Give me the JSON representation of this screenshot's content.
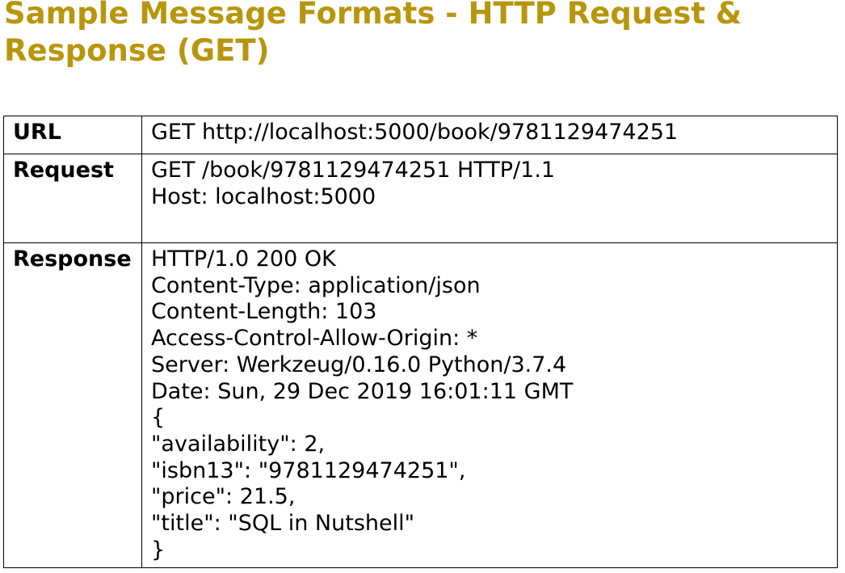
{
  "title": "Sample Message Formats - HTTP Request & Response (GET)",
  "colors": {
    "title": "#b8960c",
    "border": "#000000"
  },
  "table": {
    "rows": [
      {
        "label": "URL",
        "lines": [
          "GET http://localhost:5000/book/9781129474251"
        ]
      },
      {
        "label": "Request",
        "lines": [
          "GET /book/9781129474251 HTTP/1.1",
          "Host: localhost:5000"
        ]
      },
      {
        "label": "Response",
        "lines": [
          "HTTP/1.0 200 OK",
          "Content-Type: application/json",
          "Content-Length: 103",
          "Access-Control-Allow-Origin: *",
          "Server: Werkzeug/0.16.0 Python/3.7.4",
          "Date: Sun, 29 Dec 2019 16:01:11 GMT",
          "{",
          "\"availability\": 2,",
          "\"isbn13\": \"9781129474251\",",
          "\"price\": 21.5,",
          "\"title\": \"SQL in Nutshell\"",
          "}"
        ]
      }
    ]
  }
}
